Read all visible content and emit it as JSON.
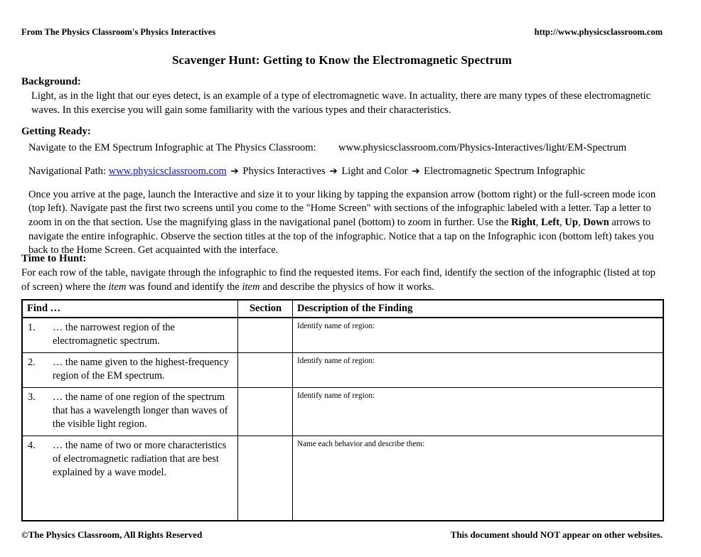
{
  "header": {
    "left": "From The Physics Classroom's Physics Interactives",
    "right": "http://www.physicsclassroom.com"
  },
  "title": "Scavenger Hunt: Getting to Know the Electromagnetic Spectrum",
  "background": {
    "heading": "Background:",
    "paragraph": "Light, as in the light that our eyes detect, is an example of a type of electromagnetic wave. In actuality, there are many types of these electromagnetic waves. In this exercise you will gain some familiarity with the various types and their characteristics."
  },
  "getting_ready": {
    "heading": "Getting Ready:",
    "navigate_label": "Navigate to the EM Spectrum Infographic at The Physics Classroom:",
    "navigate_url": "www.physicsclassroom.com/Physics-Interactives/light/EM-Spectrum",
    "nav_path_label": "Navigational Path:",
    "nav_path_link": "www.physicsclassroom.com",
    "nav_path_steps": [
      "Physics Interactives",
      "Light and Color",
      "Electromagnetic Spectrum Infographic"
    ],
    "arrow_glyph": "➔",
    "instructions_part1": "Once you arrive at the page, launch the Interactive and size it to your liking by tapping the expansion arrow (bottom right) or the full-screen mode icon (top left). Navigate past the first two screens until you come to the \"Home Screen\" with sections of the infographic labeled with a letter. Tap a letter to zoom in on the that section. Use the magnifying glass in the navigational panel (bottom) to zoom in further. Use the ",
    "instructions_bold1": "Right",
    "instructions_sep1": ", ",
    "instructions_bold2": "Left",
    "instructions_sep2": ", ",
    "instructions_bold3": "Up",
    "instructions_sep3": ", ",
    "instructions_bold4": "Down",
    "instructions_part2": " arrows to navigate the entire infographic. Observe the section titles at the top of the infographic. Notice that a tap on the Infographic icon (bottom left) takes you back to the Home Screen. Get acquainted with the interface."
  },
  "time_to_hunt": {
    "heading": "Time to Hunt:",
    "para_part1": "For each row of the table, navigate through the infographic to find the requested items. For each find, identify the section of the infographic (listed at top of screen) where the ",
    "para_italic1": "item",
    "para_part2": " was found and identify the ",
    "para_italic2": "item",
    "para_part3": " and describe the physics of how it works."
  },
  "table": {
    "columns": [
      "Find …",
      "Section",
      "Description of the Finding"
    ],
    "rows": [
      {
        "num": "1.",
        "find": "… the narrowest region of the electromagnetic spectrum.",
        "section": "",
        "prompt": "Identify name of region:",
        "answer": ""
      },
      {
        "num": "2.",
        "find": "… the name given to the highest-frequency region of the EM spectrum.",
        "section": "",
        "prompt": "Identify name of region:",
        "answer": ""
      },
      {
        "num": "3.",
        "find": "… the name of one region of the spectrum that has a wavelength longer than waves of the visible light region.",
        "section": "",
        "prompt": "Identify name of region:",
        "answer": ""
      },
      {
        "num": "4.",
        "find": "… the name of two or more characteristics of electromagnetic radiation that are best explained by a wave model.",
        "section": "",
        "prompt": "Name each behavior and describe them:",
        "answer": ""
      }
    ]
  },
  "footer": {
    "left": "©The Physics Classroom, All Rights Reserved",
    "right": "This document should NOT appear on other websites."
  },
  "colors": {
    "text": "#000000",
    "link": "#1414b4",
    "page_background": "#ffffff",
    "table_border": "#000000"
  }
}
